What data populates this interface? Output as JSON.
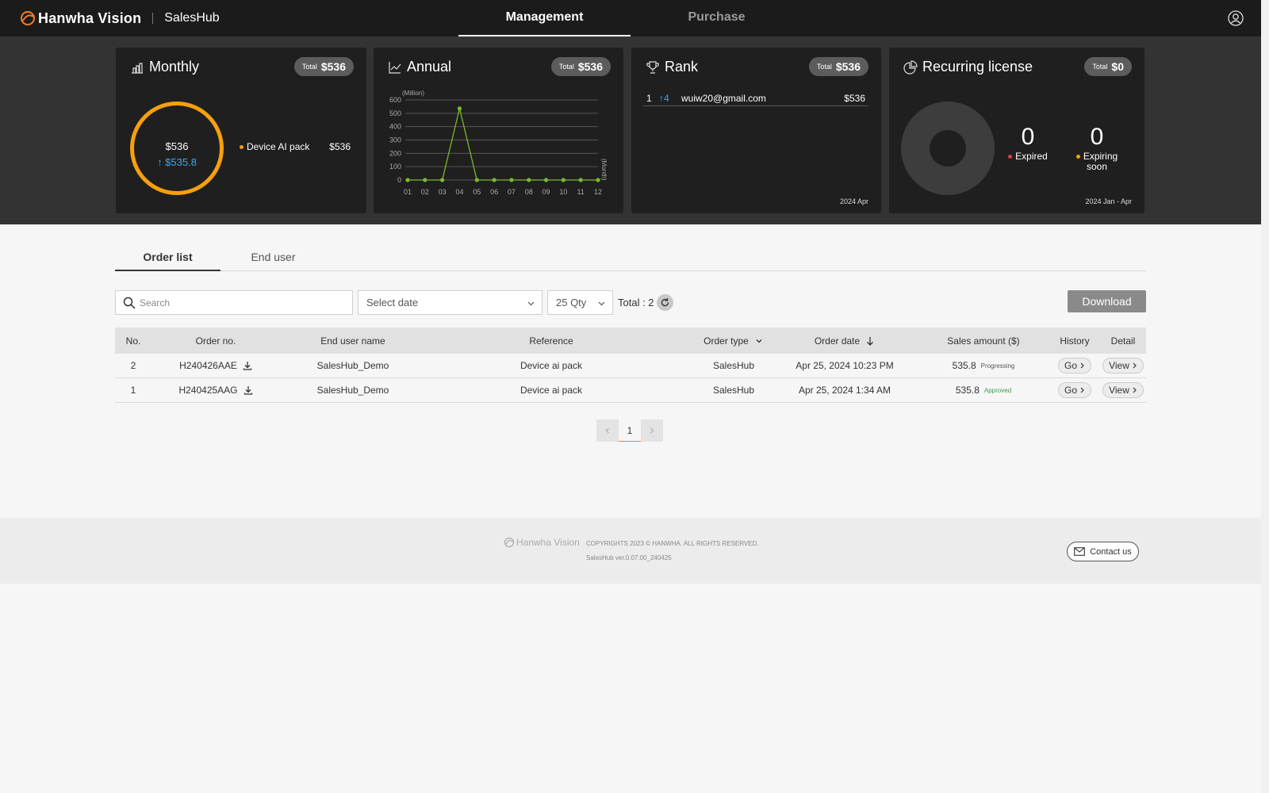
{
  "header": {
    "brand": "Hanwha Vision",
    "app_name": "SalesHub",
    "nav": [
      {
        "label": "Management",
        "active": true
      },
      {
        "label": "Purchase",
        "active": false
      }
    ]
  },
  "cards": {
    "monthly": {
      "title": "Monthly",
      "total_label": "Total",
      "total_value": "$536",
      "donut_value": "$536",
      "donut_change": "↑ $535.8",
      "legend": [
        {
          "label": "Device AI pack",
          "value": "$536",
          "color": "#f5a00c"
        }
      ]
    },
    "annual": {
      "title": "Annual",
      "total_label": "Total",
      "total_value": "$536"
    },
    "rank": {
      "title": "Rank",
      "total_label": "Total",
      "total_value": "$536",
      "rows": [
        {
          "no": "1",
          "change": "↑4",
          "email": "wuiw20@gmail.com",
          "value": "$536"
        }
      ],
      "period": "2024 Apr"
    },
    "recurring": {
      "title": "Recurring license",
      "total_label": "Total",
      "total_value": "$0",
      "expired_count": "0",
      "expired_label": "Expired",
      "expired_color": "#e83c3c",
      "expiring_count": "0",
      "expiring_label_1": "Expiring",
      "expiring_label_2": "soon",
      "expiring_color": "#f5a00c",
      "period": "2024 Jan - Apr"
    }
  },
  "chart_data": {
    "type": "line",
    "categories": [
      "01",
      "02",
      "03",
      "04",
      "05",
      "06",
      "07",
      "08",
      "09",
      "10",
      "11",
      "12"
    ],
    "series": [
      {
        "values": [
          0,
          0,
          0,
          536,
          0,
          0,
          0,
          0,
          0,
          0,
          0,
          0
        ],
        "color": "#7cb82f"
      }
    ],
    "y_ticks": [
      0,
      100,
      200,
      300,
      400,
      500,
      600
    ],
    "ylim": [
      0,
      600
    ],
    "ylabel": "(Million)",
    "xlabel": "(Month)",
    "grid": true
  },
  "tabs": [
    {
      "label": "Order list",
      "active": true
    },
    {
      "label": "End user",
      "active": false
    }
  ],
  "filters": {
    "search_placeholder": "Search",
    "date_select": "Select date",
    "qty_select": "25 Qty",
    "total": "Total : 2",
    "download_label": "Download"
  },
  "table": {
    "columns": {
      "no": "No.",
      "order_no": "Order no.",
      "end_user": "End user name",
      "reference": "Reference",
      "order_type": "Order type",
      "order_date": "Order date",
      "sales_amount": "Sales amount ($)",
      "history": "History",
      "detail": "Detail"
    },
    "rows": [
      {
        "no": "2",
        "order_no": "H240426AAE",
        "end_user": "SalesHub_Demo",
        "reference": "Device ai pack",
        "order_type": "SalesHub",
        "order_date": "Apr 25, 2024 10:23 PM",
        "amount": "535.8",
        "status": "Progressing",
        "history": "Go",
        "detail": "View"
      },
      {
        "no": "1",
        "order_no": "H240425AAG",
        "end_user": "SalesHub_Demo",
        "reference": "Device ai pack",
        "order_type": "SalesHub",
        "order_date": "Apr 25, 2024 1:34 AM",
        "amount": "535.8",
        "status": "Approved",
        "history": "Go",
        "detail": "View"
      }
    ]
  },
  "pagination": {
    "current": "1"
  },
  "footer": {
    "brand": "Hanwha Vision",
    "copyright": "COPYRIGHTS 2023 © HANWHA. ALL RIGHTS RESERVED.",
    "version": "SalesHub ver.0.07.00_240425",
    "contact_label": "Contact us"
  }
}
